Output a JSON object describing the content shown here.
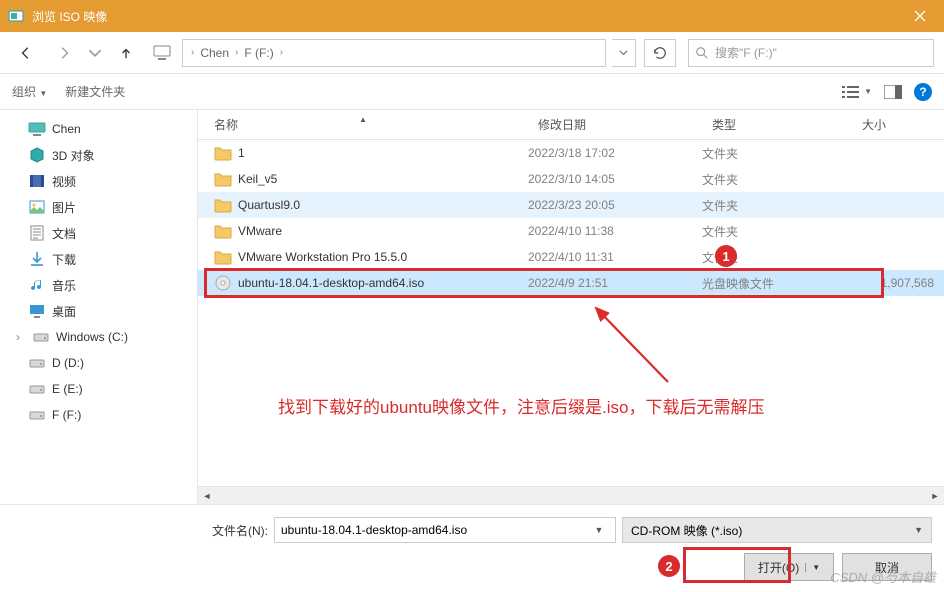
{
  "title": "浏览 ISO 映像",
  "breadcrumbs": [
    "Chen",
    "F (F:)"
  ],
  "search_placeholder": "搜索\"F (F:)\"",
  "toolbar": {
    "organize": "组织",
    "new_folder": "新建文件夹"
  },
  "columns": {
    "name": "名称",
    "date": "修改日期",
    "type": "类型",
    "size": "大小"
  },
  "tree": {
    "items": [
      {
        "label": "Chen",
        "icon": "pc"
      },
      {
        "label": "3D 对象",
        "icon": "cube"
      },
      {
        "label": "视频",
        "icon": "film"
      },
      {
        "label": "图片",
        "icon": "picture"
      },
      {
        "label": "文档",
        "icon": "doc"
      },
      {
        "label": "下载",
        "icon": "download"
      },
      {
        "label": "音乐",
        "icon": "music"
      },
      {
        "label": "桌面",
        "icon": "desktop"
      },
      {
        "label": "Windows (C:)",
        "icon": "drive",
        "expandable": true
      },
      {
        "label": "D (D:)",
        "icon": "drive"
      },
      {
        "label": "E (E:)",
        "icon": "drive"
      },
      {
        "label": "F (F:)",
        "icon": "drive"
      }
    ]
  },
  "files": [
    {
      "name": "1",
      "date": "2022/3/18 17:02",
      "type": "文件夹",
      "size": "",
      "kind": "folder"
    },
    {
      "name": "Keil_v5",
      "date": "2022/3/10 14:05",
      "type": "文件夹",
      "size": "",
      "kind": "folder"
    },
    {
      "name": "Quartusl9.0",
      "date": "2022/3/23 20:05",
      "type": "文件夹",
      "size": "",
      "kind": "folder",
      "highlighted": true
    },
    {
      "name": "VMware",
      "date": "2022/4/10 11:38",
      "type": "文件夹",
      "size": "",
      "kind": "folder"
    },
    {
      "name": "VMware Workstation Pro 15.5.0",
      "date": "2022/4/10 11:31",
      "type": "文件夹",
      "size": "",
      "kind": "folder"
    },
    {
      "name": "ubuntu-18.04.1-desktop-amd64.iso",
      "date": "2022/4/9 21:51",
      "type": "光盘映像文件",
      "size": "1,907,568",
      "kind": "iso",
      "selected": true
    }
  ],
  "file_label": "文件名(N):",
  "file_value": "ubuntu-18.04.1-desktop-amd64.iso",
  "filter_value": "CD-ROM 映像 (*.iso)",
  "open_btn": "打开(O)",
  "cancel_btn": "取消",
  "annotation_text": "找到下载好的ubuntu映像文件，注意后缀是.iso，下载后无需解压",
  "watermark": "CSDN @芍本自雄"
}
